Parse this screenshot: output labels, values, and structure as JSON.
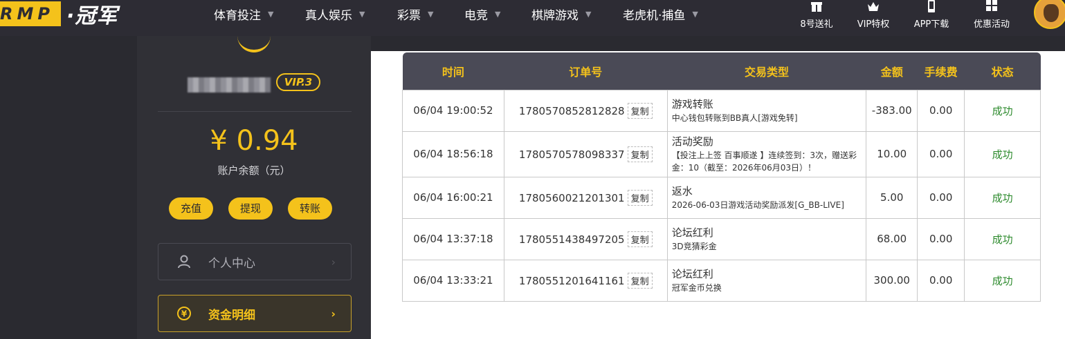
{
  "logo": {
    "abbr": "RMP",
    "name": "·冠军"
  },
  "nav": [
    {
      "label": "体育投注"
    },
    {
      "label": "真人娱乐"
    },
    {
      "label": "彩票"
    },
    {
      "label": "电竞"
    },
    {
      "label": "棋牌游戏"
    },
    {
      "label": "老虎机·捕鱼"
    }
  ],
  "toplinks": [
    {
      "label": "8号送礼",
      "icon": "gift-icon"
    },
    {
      "label": "VIP特权",
      "icon": "crown-icon"
    },
    {
      "label": "APP下载",
      "icon": "phone-icon"
    },
    {
      "label": "优惠活动",
      "icon": "grid-icon"
    }
  ],
  "profile": {
    "vip": "VIP.3",
    "balance": "¥ 0.94",
    "balance_label": "账户余额（元）",
    "actions": [
      "充值",
      "提现",
      "转账"
    ],
    "menu": [
      {
        "label": "个人中心",
        "icon": "user-icon"
      },
      {
        "label": "资金明细",
        "icon": "yen-coin-icon",
        "active": true
      }
    ]
  },
  "table": {
    "headers": [
      "时间",
      "订单号",
      "交易类型",
      "金额",
      "手续费",
      "状态"
    ],
    "copy_label": "复制",
    "rows": [
      {
        "time": "06/04 19:00:52",
        "order": "1780570852812828",
        "type": "游戏转账",
        "desc": "中心钱包转账到BB真人[游戏免转]",
        "amount": "-383.00",
        "fee": "0.00",
        "status": "成功"
      },
      {
        "time": "06/04 18:56:18",
        "order": "1780570578098337",
        "type": "活动奖励",
        "desc": "【投注上上签 百事顺遂 】连续签到：3次，赠送彩金：10（截至：2026年06月03日）！",
        "amount": "10.00",
        "fee": "0.00",
        "status": "成功"
      },
      {
        "time": "06/04 16:00:21",
        "order": "1780560021201301",
        "type": "返水",
        "desc": "2026-06-03日游戏活动奖励派发[G_BB-LIVE]",
        "amount": "5.00",
        "fee": "0.00",
        "status": "成功"
      },
      {
        "time": "06/04 13:37:18",
        "order": "1780551438497205",
        "type": "论坛红利",
        "desc": "3D竞猜彩金",
        "amount": "68.00",
        "fee": "0.00",
        "status": "成功"
      },
      {
        "time": "06/04 13:33:21",
        "order": "1780551201641161",
        "type": "论坛红利",
        "desc": "冠军金币兑换",
        "amount": "300.00",
        "fee": "0.00",
        "status": "成功"
      }
    ]
  }
}
